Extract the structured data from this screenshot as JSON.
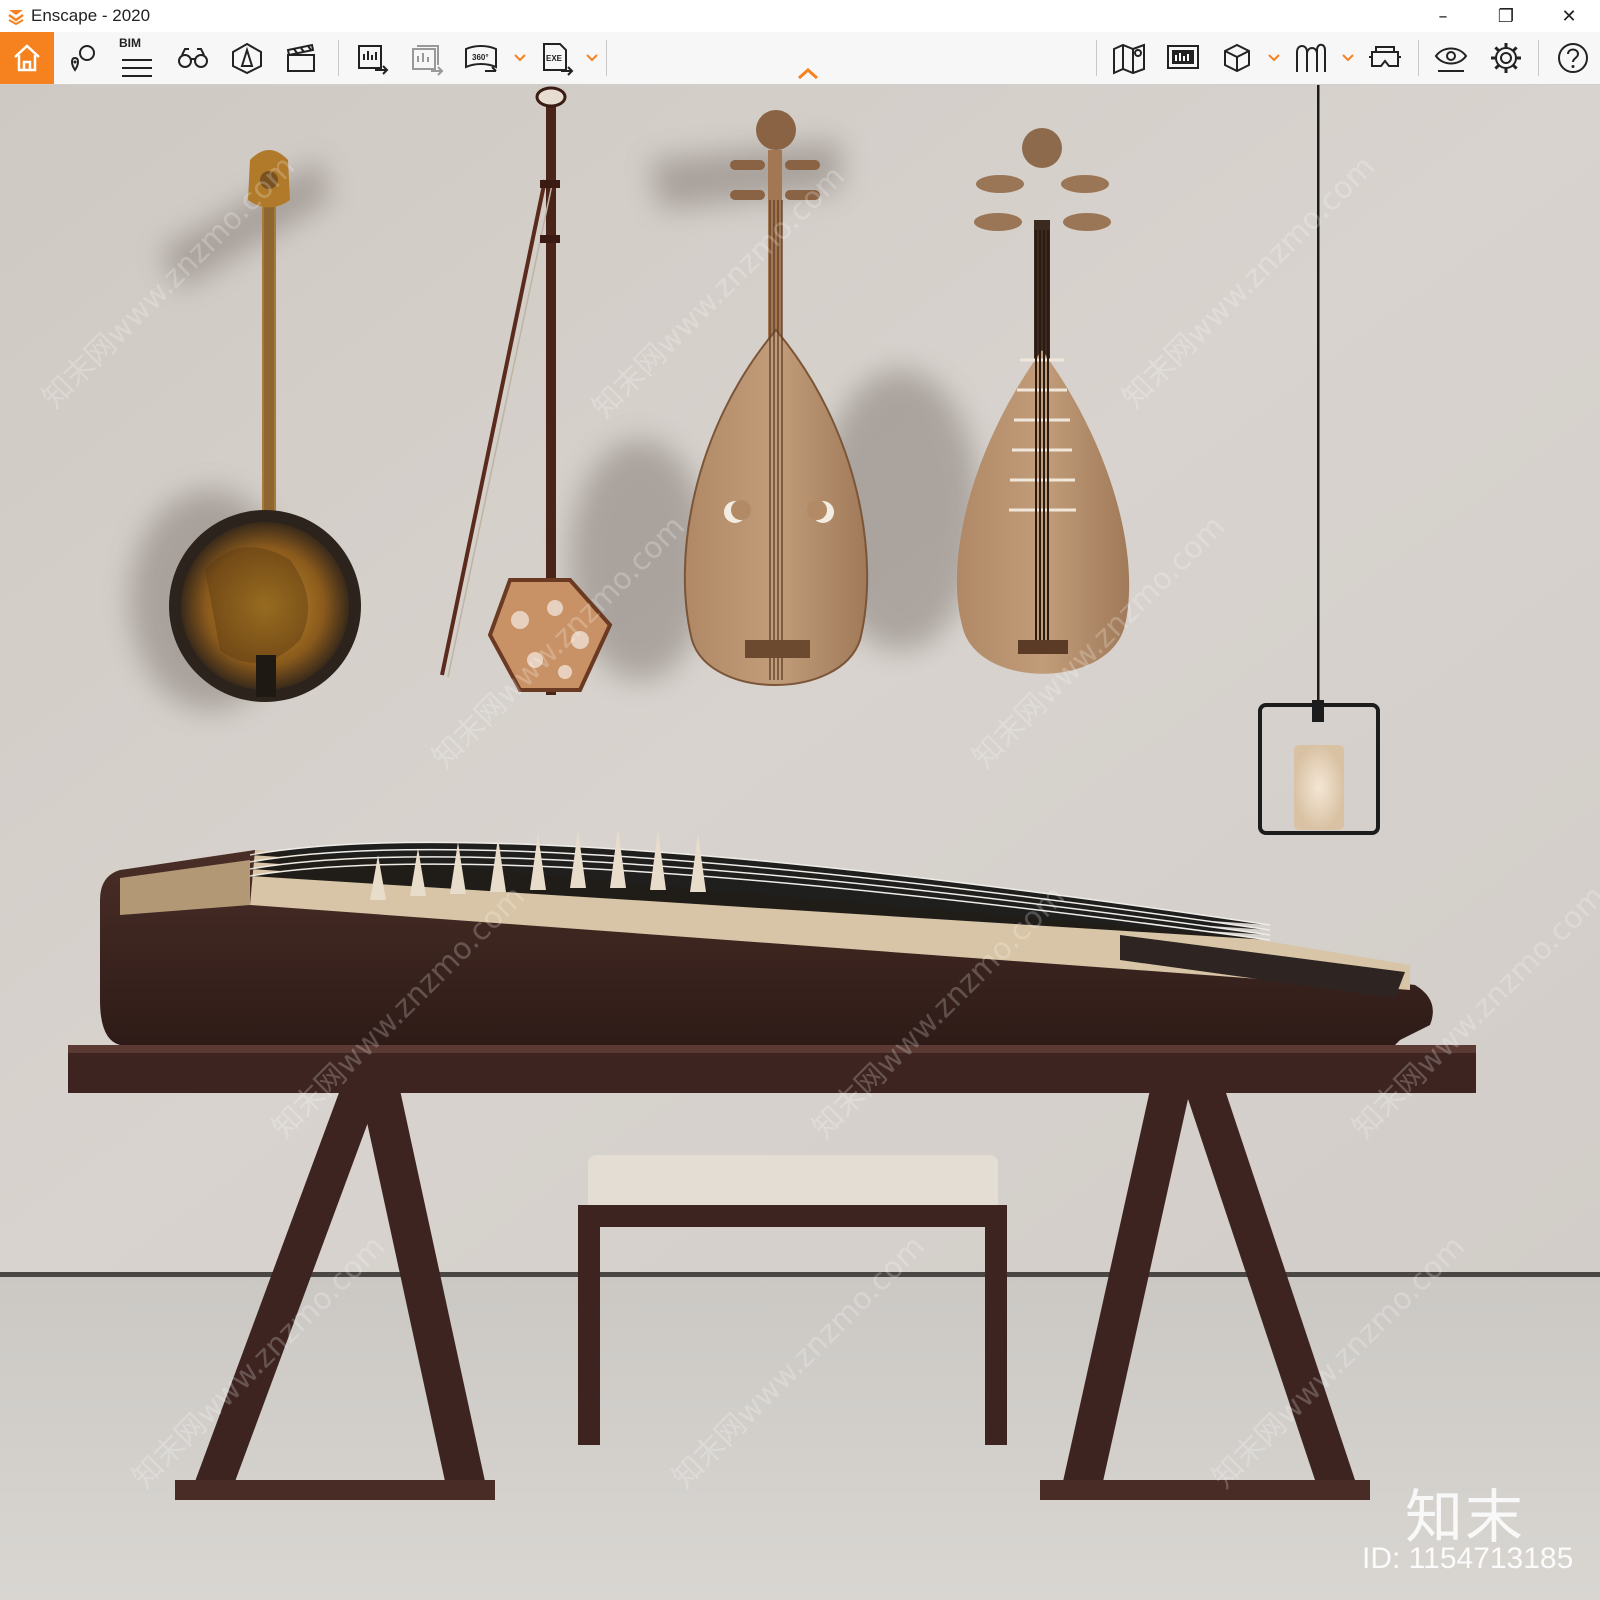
{
  "window": {
    "title": "Enscape - 2020",
    "controls": {
      "minimize": "–",
      "restore": "❐",
      "close": "✕"
    }
  },
  "toolbar": {
    "bim_label": "BIM",
    "accent_color": "#f5821f",
    "left_tools": [
      "home-icon",
      "asset-placement-icon",
      "bim-icon",
      "binoculars-icon",
      "navigation-icon",
      "video-editor-icon"
    ],
    "export_tools": [
      "screenshot-export-icon",
      "batch-export-icon",
      "panorama-360-icon",
      "exe-export-icon"
    ],
    "right_tools": [
      "map-icon",
      "views-icon",
      "cube-icon",
      "material-icon",
      "vr-headset-icon",
      "visual-settings-icon",
      "settings-icon",
      "help-icon"
    ]
  },
  "viewport": {
    "scene": "render",
    "watermark_logo": "知末",
    "watermark_id": "ID: 1154713185",
    "watermark_text": "知末网www.znzmo.com"
  }
}
